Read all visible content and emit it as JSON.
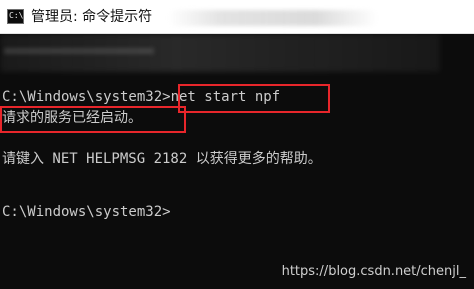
{
  "window": {
    "title": "管理员: 命令提示符",
    "icon": "cmd-icon",
    "icon_glyph": "C:\\"
  },
  "console": {
    "lines": [
      "C:\\Windows\\system32>net start npf",
      "请求的服务已经启动。",
      "请键入 NET HELPMSG 2182 以获得更多的帮助。",
      "C:\\Windows\\system32>"
    ]
  },
  "watermark": "https://blog.csdn.net/chenjl_",
  "colors": {
    "console_bg": "#0c0c0c",
    "console_text": "#cccccc",
    "highlight": "#e8262b",
    "titlebar_bg": "#ffffff"
  }
}
